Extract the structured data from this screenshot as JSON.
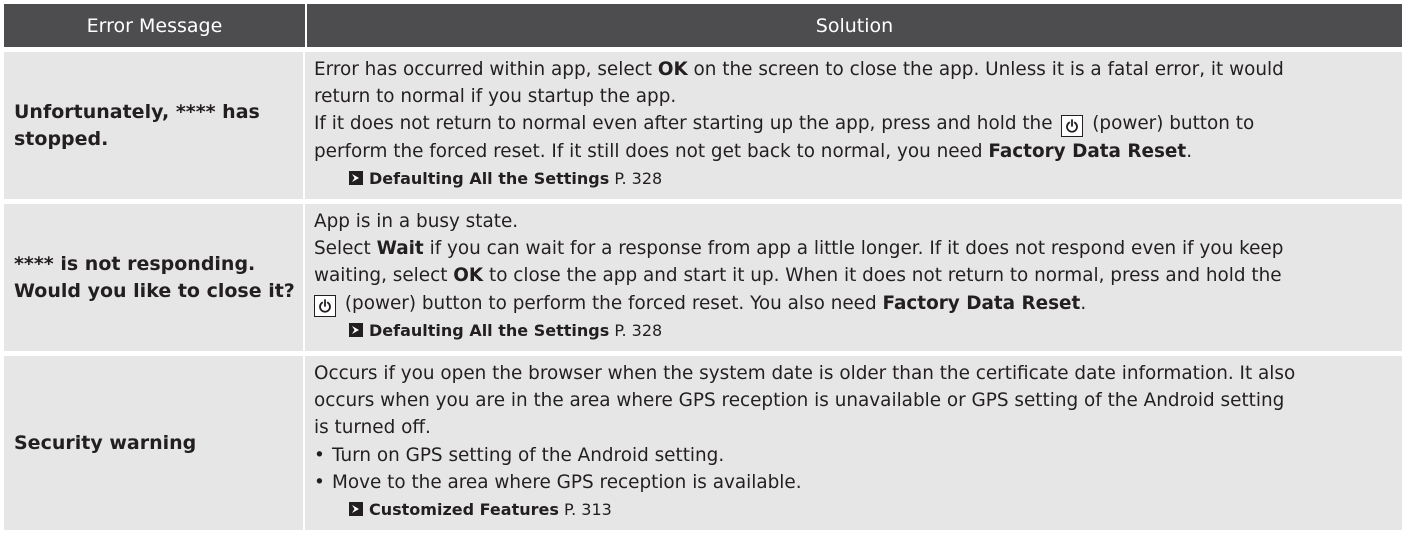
{
  "header": {
    "col1": "Error Message",
    "col2": "Solution"
  },
  "rows": [
    {
      "key": "Unfortunately, **** has stopped.",
      "line1": [
        "Error has occurred within app, select ",
        "OK",
        " on the screen to close the app. Unless it is a fatal error, it would"
      ],
      "line2": "return to normal if you startup the app.",
      "line3": [
        "If it does not return to normal even after starting up the app, press and hold the ",
        " (power) button to"
      ],
      "line4": [
        "perform the forced reset. If it still does not get back to normal, you need ",
        "Factory Data Reset",
        "."
      ],
      "ref": {
        "title": "Defaulting All the Settings",
        "page": "P. 328"
      }
    },
    {
      "key": "**** is not responding. Would you like to close it?",
      "line1": "App is in a busy state.",
      "line2": [
        "Select ",
        "Wait",
        " if you can wait for a response from app a little longer. If it does not respond even if you keep"
      ],
      "line3": [
        "waiting, select ",
        "OK",
        " to close the app and start it up. When it does not return to normal, press and hold the"
      ],
      "line4": [
        " (power) button to perform the forced reset. You also need ",
        "Factory Data Reset",
        "."
      ],
      "ref": {
        "title": "Defaulting All the Settings",
        "page": "P. 328"
      }
    },
    {
      "key": "Security warning",
      "line1": "Occurs if you open the browser when the system date is older than the certificate date information. It also",
      "line2": "occurs when you are in the area where GPS reception is unavailable or GPS setting of the Android setting",
      "line3": "is turned off.",
      "bullets": [
        "Turn on GPS setting of the Android setting.",
        "Move to the area where GPS reception is available."
      ],
      "ref": {
        "title": "Customized Features",
        "page": "P. 313"
      }
    }
  ]
}
